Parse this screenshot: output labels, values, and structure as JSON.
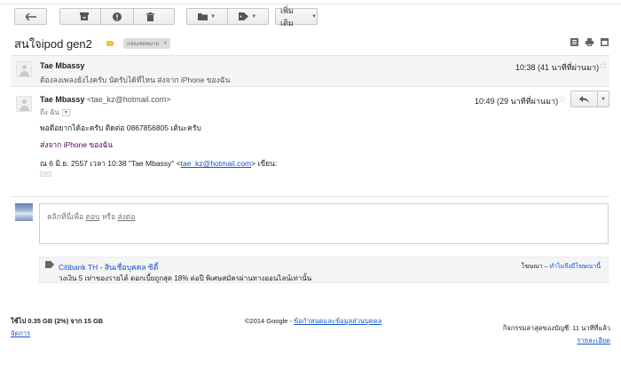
{
  "toolbar": {
    "back_icon": "back-arrow-icon",
    "more_label": "เพิ่มเติม"
  },
  "thread": {
    "subject": "สนใจipod gen2",
    "label": "กล่องจดหมาย",
    "label_remove": "x"
  },
  "messages": [
    {
      "sender": "Tae Mbassy",
      "snippet": "ต้องลงเพลงยังไงครับ นัดรับได้ที่ไหน ส่งจาก iPhone ของฉัน",
      "date": "10:38 (41 นาทีที่ผ่านมา)"
    },
    {
      "sender": "Tae Mbassy",
      "email": "<tae_kz@hotmail.com>",
      "to": "ถึง ฉัน",
      "date": "10:49 (29 นาทีที่ผ่านมา)",
      "body1": "พอดีอยากได้อะครับ ติดต่อ 0867856805 เต้นะครับ",
      "signature": "ส่งจาก iPhone ของฉัน",
      "quote_prefix": "ณ 6 มิ.ย. 2557 เวลา 10:38 \"Tae Mbassy\" <",
      "quote_link": "tae_kz@hotmail.com",
      "quote_suffix": "> เขียน:",
      "ellipsis": "..."
    }
  ],
  "reply": {
    "prefix": "คลิกที่นี่เพื่อ ",
    "reply_link": "ตอบ",
    "or": " หรือ ",
    "forward_link": "ส่งต่อ"
  },
  "ad": {
    "advertiser": "Citibank TH",
    "separator": " - ",
    "headline": "สินเชื่อบุคคล ซิตี้",
    "body": "วงเงิน 5 เท่าของรายได้ ดอกเบี้ยถูกสุด 18% ต่อปี พิเศษสมัครผ่านทางออนไลน์เท่านั้น",
    "right_prefix": "โฆษณา – ",
    "right_link": "ทำไมจึงมีโฆษณานี้"
  },
  "footer": {
    "storage": "ใช้ไป 0.35 GB (2%) จาก 15 GB",
    "manage": "จัดการ",
    "copyright": "©2014 Google - ",
    "policy_link": "ข้อกำหนดและข้อมูลส่วนบุคคล",
    "activity": "กิจกรรมล่าสุดของบัญชี: 11 นาทีที่แล้ว",
    "details": "รายละเอียด"
  }
}
